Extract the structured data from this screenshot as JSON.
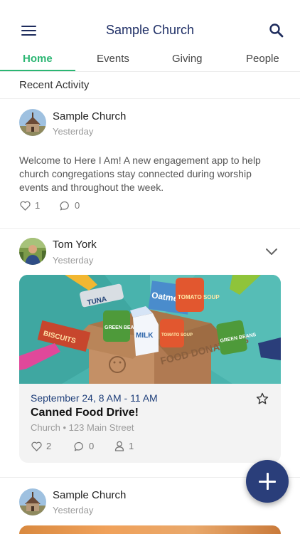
{
  "header": {
    "title": "Sample Church"
  },
  "tabs": [
    {
      "label": "Home",
      "active": true
    },
    {
      "label": "Events",
      "active": false
    },
    {
      "label": "Giving",
      "active": false
    },
    {
      "label": "People",
      "active": false
    }
  ],
  "feed": {
    "section_title": "Recent Activity",
    "posts": [
      {
        "author": "Sample Church",
        "time": "Yesterday",
        "body": "Welcome to Here I Am! A new engagement app to help church congregations stay connected during worship events and throughout the week.",
        "likes": "1",
        "comments": "0"
      },
      {
        "author": "Tom York",
        "time": "Yesterday",
        "event": {
          "image_text": [
            "TUNA",
            "Oatmeal",
            "TOMATO SOUP",
            "GREEN BEANS",
            "MILK",
            "BISCUITS",
            "TOMATO SOUP",
            "GREEN BEANS",
            "FOOD DONATIONS"
          ],
          "date": "September 24, 8 AM - 11 AM",
          "title": "Canned Food Drive!",
          "location": "Church • 123 Main Street",
          "likes": "2",
          "comments": "0",
          "attendees": "1"
        }
      },
      {
        "author": "Sample Church",
        "time": "Yesterday"
      }
    ]
  },
  "colors": {
    "accent": "#2bb673",
    "brand": "#1f2f66",
    "fab": "#2a3e7a"
  }
}
